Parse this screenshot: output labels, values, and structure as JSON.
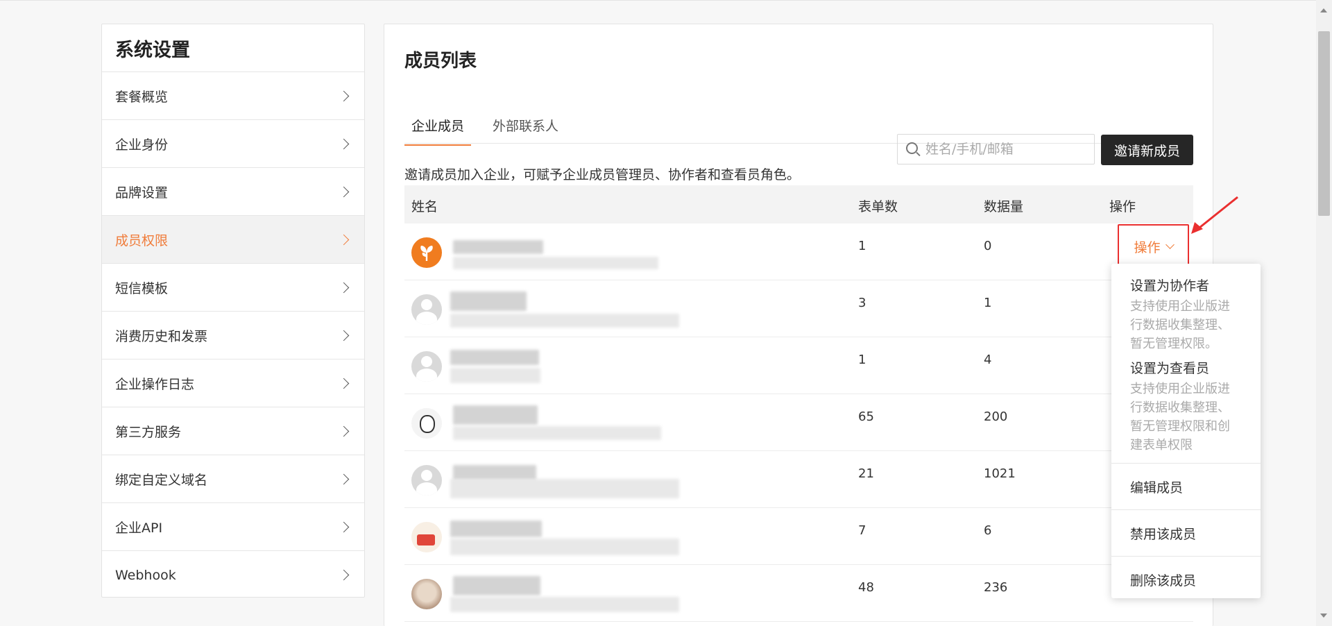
{
  "sidebar": {
    "title": "系统设置",
    "items": [
      {
        "label": "套餐概览"
      },
      {
        "label": "企业身份"
      },
      {
        "label": "品牌设置"
      },
      {
        "label": "成员权限"
      },
      {
        "label": "短信模板"
      },
      {
        "label": "消费历史和发票"
      },
      {
        "label": "企业操作日志"
      },
      {
        "label": "第三方服务"
      },
      {
        "label": "绑定自定义域名"
      },
      {
        "label": "企业API"
      },
      {
        "label": "Webhook"
      }
    ],
    "active_index": 3
  },
  "main": {
    "title": "成员列表",
    "tabs": [
      {
        "label": "企业成员"
      },
      {
        "label": "外部联系人"
      }
    ],
    "description": "邀请成员加入企业，可赋予企业成员管理员、协作者和查看员角色。",
    "search_placeholder": "姓名/手机/邮箱",
    "invite_button": "邀请新成员",
    "table": {
      "headers": {
        "name": "姓名",
        "forms": "表单数",
        "data": "数据量",
        "op": "操作"
      },
      "rows": [
        {
          "forms": "1",
          "data": "0",
          "avatar": "sprout-icon"
        },
        {
          "forms": "3",
          "data": "1",
          "avatar": "default-user-icon"
        },
        {
          "forms": "1",
          "data": "4",
          "avatar": "default-user-icon"
        },
        {
          "forms": "65",
          "data": "200",
          "avatar": "panda-icon"
        },
        {
          "forms": "21",
          "data": "1021",
          "avatar": "default-user-icon"
        },
        {
          "forms": "7",
          "data": "6",
          "avatar": "book-bear-icon"
        },
        {
          "forms": "48",
          "data": "236",
          "avatar": "cat-photo"
        }
      ]
    },
    "op_trigger": "操作"
  },
  "menu": {
    "set_collaborator": "设置为协作者",
    "set_collaborator_hint": [
      "支持使用企业版进",
      "行数据收集整理、",
      "暂无管理权限。"
    ],
    "set_viewer": "设置为查看员",
    "set_viewer_hint": [
      "支持使用企业版进",
      "行数据收集整理、",
      "暂无管理权限和创",
      "建表单权限"
    ],
    "edit": "编辑成员",
    "disable": "禁用该成员",
    "delete": "删除该成员"
  },
  "colors": {
    "accent": "#f07c3a",
    "annotation": "#ea2f2f",
    "button_dark": "#262626"
  }
}
